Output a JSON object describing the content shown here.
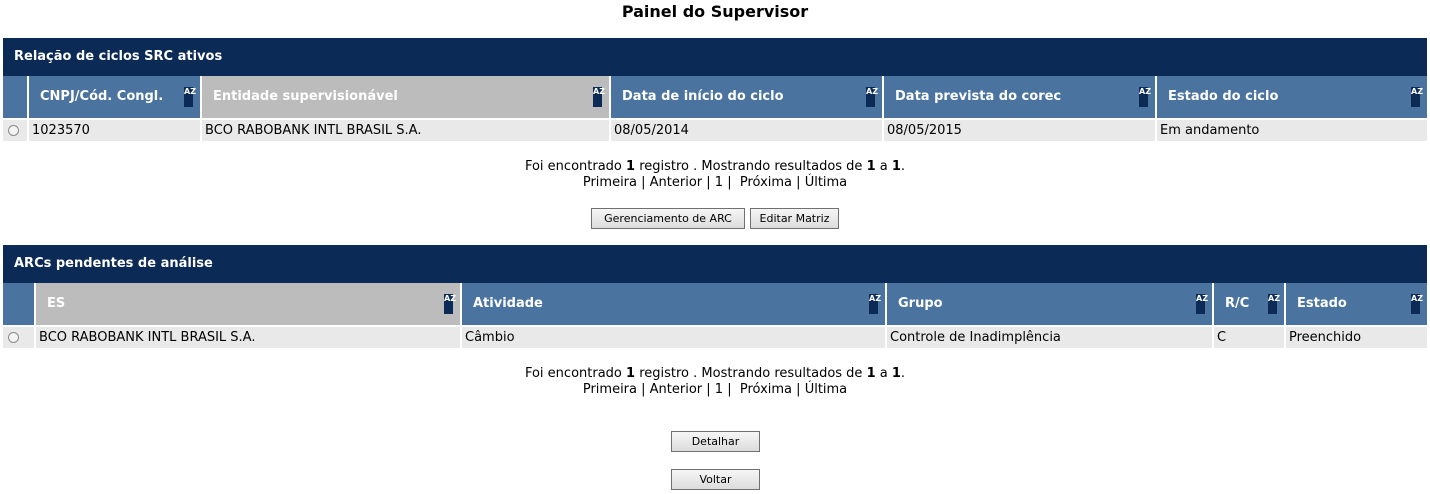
{
  "page_title": "Painel do Supervisor",
  "sort_icon_label": "AZ",
  "ciclos": {
    "title": "Relação de ciclos SRC ativos",
    "headers": [
      "CNPJ/Cód. Congl.",
      "Entidade supervisionável",
      "Data de início do ciclo",
      "Data prevista do corec",
      "Estado do ciclo"
    ],
    "rows": [
      [
        "1023570",
        "BCO RABOBANK INTL BRASIL S.A.",
        "08/05/2014",
        "08/05/2015",
        "Em andamento"
      ]
    ],
    "pager": {
      "prefix": "Foi encontrado ",
      "count": "1",
      "middle": " registro . Mostrando resultados de ",
      "from": "1",
      "sep": " a ",
      "to": "1",
      "end": ".",
      "first": "Primeira",
      "prev": "Anterior",
      "page": "1",
      "next": "Próxima",
      "last": "Última"
    },
    "buttons": {
      "gerenciamento": "Gerenciamento de ARC",
      "editar": "Editar Matriz"
    }
  },
  "arcs": {
    "title": "ARCs pendentes de análise",
    "headers": [
      "ES",
      "Atividade",
      "Grupo",
      "R/C",
      "Estado"
    ],
    "rows": [
      [
        "BCO RABOBANK INTL BRASIL S.A.",
        "Câmbio",
        "Controle de Inadimplência",
        "C",
        "Preenchido"
      ]
    ],
    "pager": {
      "prefix": "Foi encontrado ",
      "count": "1",
      "middle": " registro . Mostrando resultados de ",
      "from": "1",
      "sep": " a ",
      "to": "1",
      "end": ".",
      "first": "Primeira",
      "prev": "Anterior",
      "page": "1",
      "next": "Próxima",
      "last": "Última"
    },
    "buttons": {
      "detalhar": "Detalhar",
      "voltar": "Voltar"
    }
  }
}
